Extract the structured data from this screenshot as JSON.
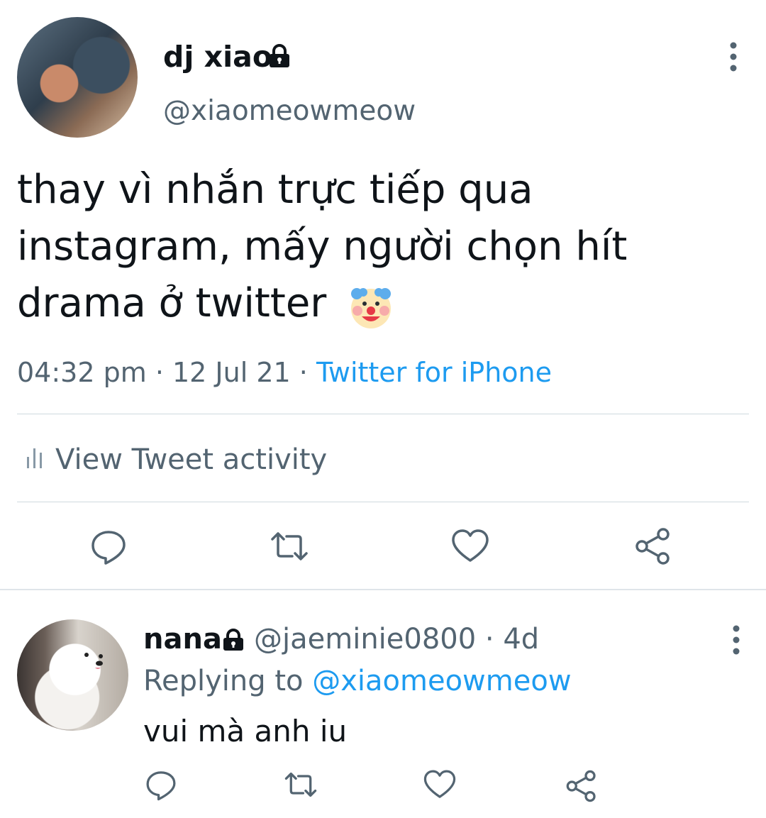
{
  "tweet": {
    "author_name": "dj xiao",
    "author_handle": "@xiaomeowmeow",
    "text": "thay vì nhắn trực tiếp qua\ninstagram, mấy người chọn hít\ndrama ở twitter",
    "emoji": "clown-face",
    "time": "04:32 pm",
    "date": "12 Jul 21",
    "separator": " · ",
    "source": "Twitter for iPhone",
    "activity_label": "View Tweet activity"
  },
  "reply": {
    "author_name": "nana",
    "author_handle": "@jaeminie0800",
    "age": "4d",
    "replying_prefix": "Replying to ",
    "replying_to": "@xiaomeowmeow",
    "text": "vui mà anh iu"
  },
  "icons": {
    "protected": "lock-icon",
    "more": "more-vertical-icon",
    "reply": "reply-icon",
    "retweet": "retweet-icon",
    "like": "heart-icon",
    "share": "share-icon",
    "activity": "bar-chart-icon"
  },
  "colors": {
    "accent": "#1d9bf0",
    "secondary_text": "#536471",
    "primary_text": "#0f1419",
    "divider": "#cfd9de"
  }
}
